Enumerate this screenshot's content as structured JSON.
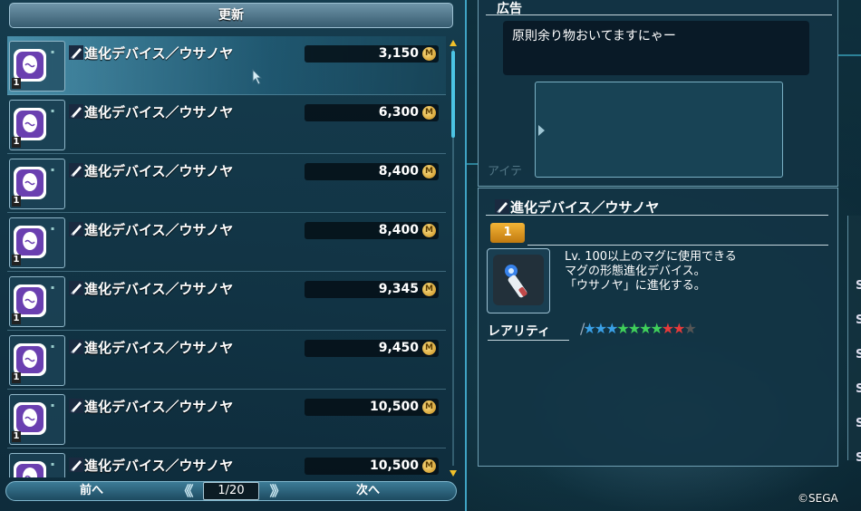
{
  "left": {
    "refresh_label": "更新",
    "items": [
      {
        "name": "進化デバイス／ウサノヤ",
        "price": "3,150",
        "selected": true
      },
      {
        "name": "進化デバイス／ウサノヤ",
        "price": "6,300"
      },
      {
        "name": "進化デバイス／ウサノヤ",
        "price": "8,400"
      },
      {
        "name": "進化デバイス／ウサノヤ",
        "price": "8,400"
      },
      {
        "name": "進化デバイス／ウサノヤ",
        "price": "9,345"
      },
      {
        "name": "進化デバイス／ウサノヤ",
        "price": "9,450"
      },
      {
        "name": "進化デバイス／ウサノヤ",
        "price": "10,500"
      },
      {
        "name": "進化デバイス／ウサノヤ",
        "price": "10,500"
      }
    ],
    "thumb_count": "1",
    "meseta_symbol": "M"
  },
  "pager": {
    "prev_label": "前へ",
    "next_label": "次へ",
    "page": "1/20",
    "left_arrows": "《《",
    "right_arrows": "》》"
  },
  "ad": {
    "title": "広告",
    "message": "原則余り物おいてますにゃー",
    "ghost_text": "アイテ"
  },
  "detail": {
    "title": "進化デバイス／ウサノヤ",
    "level_badge": "1",
    "description_lines": [
      "Lv. 100以上のマグに使用できる",
      "マグの形態進化デバイス。",
      "「ウサノヤ」に進化する。"
    ],
    "rarity_label": "レアリティ",
    "rarity_slash": "/",
    "rarity_stars": [
      {
        "glyph": "★",
        "color": "#3aa0e6"
      },
      {
        "glyph": "★",
        "color": "#3aa0e6"
      },
      {
        "glyph": "★",
        "color": "#3aa0e6"
      },
      {
        "glyph": "★",
        "color": "#3fd05a"
      },
      {
        "glyph": "★",
        "color": "#3fd05a"
      },
      {
        "glyph": "★",
        "color": "#3fd05a"
      },
      {
        "glyph": "★",
        "color": "#3fd05a"
      },
      {
        "glyph": "★",
        "color": "#e63a3a"
      },
      {
        "glyph": "★",
        "color": "#e63a3a"
      },
      {
        "glyph": "★",
        "color": "#555555"
      }
    ]
  },
  "edge_letters": [
    "S",
    "S",
    "S",
    "S",
    "S",
    "S"
  ],
  "copyright": "©SEGA",
  "colors": {
    "accent": "#3fa3c4",
    "badge": "#f4b436",
    "selected_row": "#5aaac8"
  }
}
